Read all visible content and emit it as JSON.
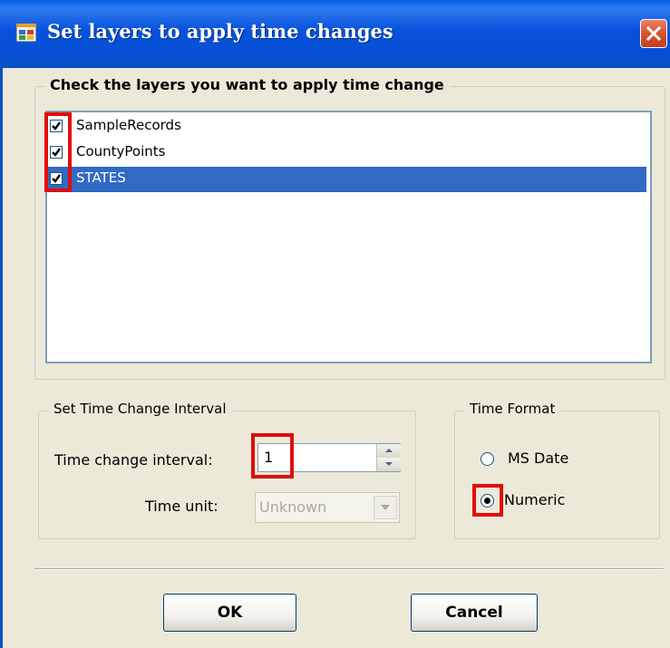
{
  "window": {
    "title": "Set layers to apply time changes"
  },
  "layers_group": {
    "legend": "Check the layers you want to apply time change",
    "items": [
      {
        "label": "SampleRecords",
        "checked": true,
        "selected": false
      },
      {
        "label": "CountyPoints",
        "checked": true,
        "selected": false
      },
      {
        "label": "STATES",
        "checked": true,
        "selected": true
      }
    ]
  },
  "interval_group": {
    "legend": "Set Time Change Interval",
    "interval_label": "Time change interval:",
    "interval_value": "1",
    "unit_label": "Time unit:",
    "unit_value": "Unknown"
  },
  "format_group": {
    "legend": "Time Format",
    "options": [
      {
        "label": "MS Date",
        "selected": false
      },
      {
        "label": "Numeric",
        "selected": true
      }
    ]
  },
  "buttons": {
    "ok": "OK",
    "cancel": "Cancel"
  },
  "colors": {
    "highlight": "#E30B0B",
    "selection": "#316AC5",
    "titlebar": "#0550D4"
  }
}
